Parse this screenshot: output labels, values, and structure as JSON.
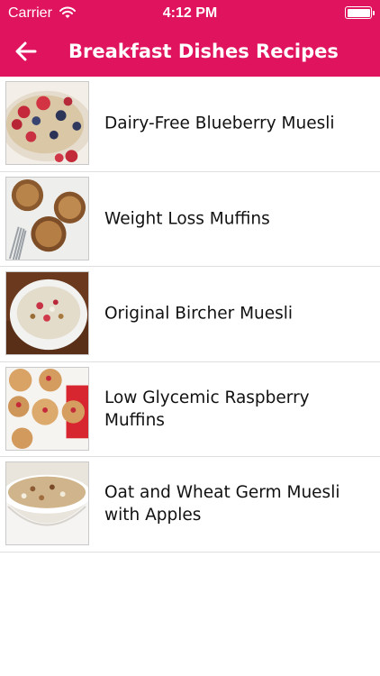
{
  "status_bar": {
    "carrier": "Carrier",
    "time": "4:12 PM",
    "wifi_icon": "wifi-icon",
    "battery_icon": "battery-icon"
  },
  "header": {
    "title": "Breakfast Dishes Recipes",
    "back_icon": "arrow-left-icon",
    "background_color": "#e0145e",
    "text_color": "#ffffff"
  },
  "recipes": [
    {
      "label": "Dairy-Free Blueberry Muesli",
      "thumbnail": "muesli-with-berries"
    },
    {
      "label": "Weight Loss Muffins",
      "thumbnail": "muffins-on-plate-with-fork"
    },
    {
      "label": "Original Bircher Muesli",
      "thumbnail": "bircher-muesli-bowl"
    },
    {
      "label": "Low Glycemic Raspberry Muffins",
      "thumbnail": "raspberry-muffins"
    },
    {
      "label": "Oat and Wheat Germ Muesli with Apples",
      "thumbnail": "oat-muesli-cup"
    }
  ]
}
